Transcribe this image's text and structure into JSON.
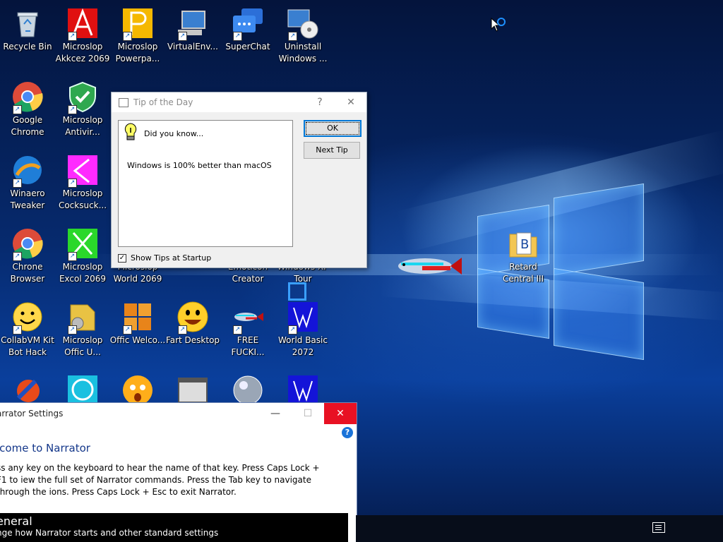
{
  "desktop_icons": [
    {
      "label": "Recycle Bin",
      "icon": "recycle-bin-icon"
    },
    {
      "label": "Microslop Akkcez 2069",
      "icon": "access-icon"
    },
    {
      "label": "Microslop Powerpa...",
      "icon": "powerpoint-icon"
    },
    {
      "label": "VirtualEnv...",
      "icon": "computer-icon"
    },
    {
      "label": "SuperChat",
      "icon": "chat-icon"
    },
    {
      "label": "Uninstall Windows ...",
      "icon": "uninstall-icon"
    },
    {
      "label": "Google Chrome",
      "icon": "chrome-icon"
    },
    {
      "label": "Microslop Antivir...",
      "icon": "antivirus-shield-icon"
    },
    {
      "label": "Winaero Tweaker",
      "icon": "winaero-icon"
    },
    {
      "label": "Microslop Cocksuck...",
      "icon": "pink-app-icon"
    },
    {
      "label": "Chrone Browser",
      "icon": "chrome-icon"
    },
    {
      "label": "Microslop Excol 2069",
      "icon": "excel-icon"
    },
    {
      "label": "Microslop World 2069",
      "icon": "word-icon"
    },
    {
      "label": "Emoticon Creator",
      "icon": "emoticon-icon"
    },
    {
      "label": "Windows XP Tour",
      "icon": "xp-tour-icon"
    },
    {
      "label": "Retard Central III",
      "icon": "folder-icon"
    },
    {
      "label": "CollabVM Kit Bot Hack",
      "icon": "smiley-icon"
    },
    {
      "label": "Microslop Offic U...",
      "icon": "office-update-icon"
    },
    {
      "label": "Offic Welco...",
      "icon": "office-icon"
    },
    {
      "label": "Fart Desktop",
      "icon": "smiley-icon"
    },
    {
      "label": "FREE FUCKI...",
      "icon": "fish-icon"
    },
    {
      "label": "World Basic 2072",
      "icon": "basic-icon"
    }
  ],
  "tip_dialog": {
    "title": "Tip of the Day",
    "heading": "Did you know...",
    "message": "Windows is 100% better than macOS",
    "ok_label": "OK",
    "next_label": "Next Tip",
    "help_glyph": "?",
    "close_glyph": "✕",
    "show_tips_label": "Show Tips at Startup",
    "show_tips_checked": true
  },
  "narrator": {
    "title": "arrator Settings",
    "heading": "lcome to Narrator",
    "body": "ss any key on the keyboard to hear the name of that key.  Press Caps Lock + F1 to iew the full set of Narrator commands.  Press the Tab key to navigate through the ions.  Press Caps Lock + Esc to exit Narrator.",
    "section_title": "eneral",
    "section_subtitle": "nge how Narrator starts and other standard settings",
    "minimize_glyph": "—",
    "maximize_glyph": "☐",
    "close_glyph": "✕",
    "help_glyph": "?"
  },
  "colors": {
    "accent": "#0078d7",
    "close_red": "#e81123"
  }
}
